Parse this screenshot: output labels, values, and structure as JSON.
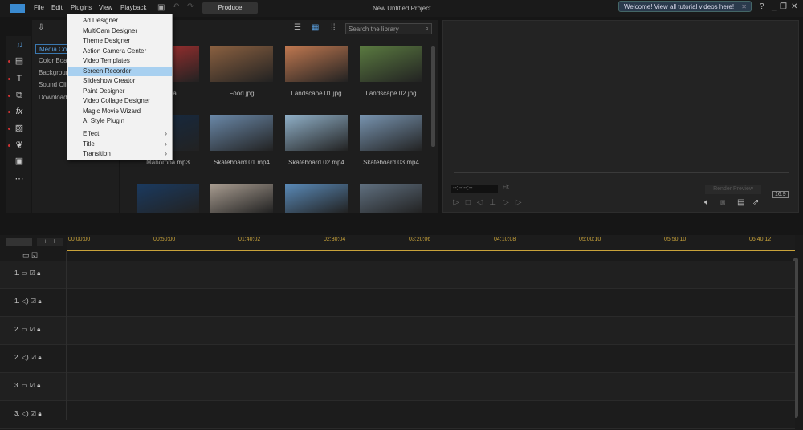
{
  "menubar": {
    "items": [
      "File",
      "Edit",
      "Plugins",
      "View",
      "Playback"
    ],
    "produce": "Produce",
    "title": "New Untitled Project",
    "welcome": "Welcome! View all tutorial videos here!"
  },
  "plugins_menu": {
    "items": [
      "Ad Designer",
      "MultiCam Designer",
      "Theme Designer",
      "Action Camera Center",
      "Video Templates",
      "Screen Recorder",
      "Slideshow Creator",
      "Paint Designer",
      "Video Collage Designer",
      "Magic Movie Wizard",
      "AI Style Plugin"
    ],
    "submenus": [
      "Effect",
      "Title",
      "Transition"
    ],
    "selected": "Screen Recorder"
  },
  "sub_panel": {
    "items": [
      "Media Content",
      "Color Boards",
      "Backgrounds",
      "Sound Clips",
      "Downloads"
    ]
  },
  "library": {
    "search_placeholder": "Search the library",
    "items": [
      {
        "name": "Media",
        "thumb": "#b03030"
      },
      {
        "name": "Food.jpg",
        "thumb": "#8a6040"
      },
      {
        "name": "Landscape 01.jpg",
        "thumb": "#c07850"
      },
      {
        "name": "Landscape 02.jpg",
        "thumb": "#5a7a40"
      },
      {
        "name": "Mahoroba.mp3",
        "thumb": "#142a44"
      },
      {
        "name": "Skateboard 01.mp4",
        "thumb": "#6a88a8"
      },
      {
        "name": "Skateboard 02.mp4",
        "thumb": "#90b0c8"
      },
      {
        "name": "Skateboard 03.mp4",
        "thumb": "#7894b0"
      },
      {
        "name": "",
        "thumb": "#1a3a60"
      },
      {
        "name": "",
        "thumb": "#a89c90"
      },
      {
        "name": "",
        "thumb": "#5a8ab8"
      },
      {
        "name": "",
        "thumb": "#607080"
      }
    ]
  },
  "preview": {
    "timecode": "--;--;--;--",
    "fit": "Fit",
    "render": "Render Preview",
    "aspect": "16:9"
  },
  "timeline": {
    "ticks": [
      "00;00;00",
      "00;50;00",
      "01;40;02",
      "02;30;04",
      "03;20;06",
      "04;10;08",
      "05;00;10",
      "05;50;10",
      "06;40;12"
    ],
    "tracks": [
      "1.",
      "1.",
      "2.",
      "2.",
      "3.",
      "3."
    ]
  }
}
